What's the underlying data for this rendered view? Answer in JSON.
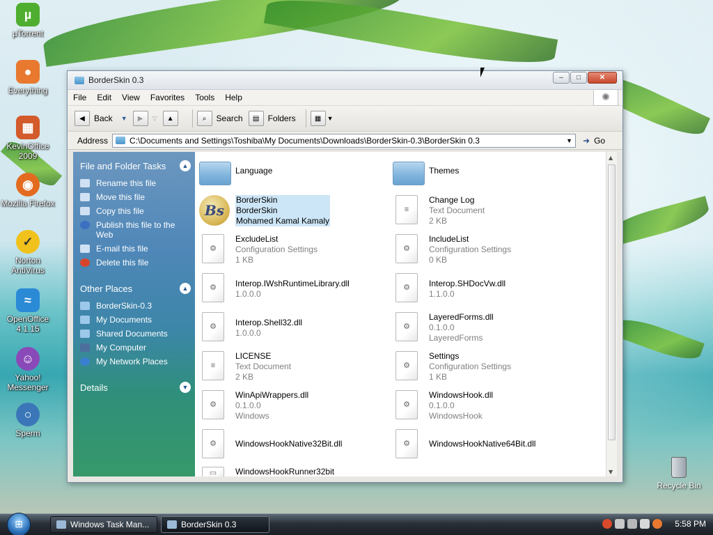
{
  "desktop": {
    "icons": [
      {
        "label": "µTorrent",
        "symbol": "µ",
        "color": "#4fae2f"
      },
      {
        "label": "Everything",
        "symbol": "●",
        "color": "#e8792f"
      },
      {
        "label": "KevinOffice 2009",
        "symbol": "▦",
        "color": "#d35a2b"
      },
      {
        "label": "Mozilla Firefox",
        "symbol": "◉",
        "color": "#e36b20"
      },
      {
        "label": "Norton AntiVirus",
        "symbol": "✓",
        "color": "#f0c21b"
      },
      {
        "label": "OpenOffice 4.1.15",
        "symbol": "≈",
        "color": "#2a8ad6"
      },
      {
        "label": "Yahoo! Messenger",
        "symbol": "☺",
        "color": "#8a49b8"
      },
      {
        "label": "Sperm",
        "symbol": "○",
        "color": "#3b77b8"
      }
    ],
    "recycle_bin_label": "Recycle Bin"
  },
  "window": {
    "title": "BorderSkin 0.3",
    "menu": [
      "File",
      "Edit",
      "View",
      "Favorites",
      "Tools",
      "Help"
    ],
    "toolbar": {
      "back_label": "Back",
      "search_label": "Search",
      "folders_label": "Folders"
    },
    "address": {
      "label": "Address",
      "value": "C:\\Documents and Settings\\Toshiba\\My Documents\\Downloads\\BorderSkin-0.3\\BorderSkin 0.3",
      "go_label": "Go"
    },
    "task_pane": {
      "file_tasks": {
        "title": "File and Folder Tasks",
        "items": [
          "Rename this file",
          "Move this file",
          "Copy this file",
          "Publish this file to the Web",
          "E-mail this file",
          "Delete this file"
        ]
      },
      "other_places": {
        "title": "Other Places",
        "items": [
          "BorderSkin-0.3",
          "My Documents",
          "Shared Documents",
          "My Computer",
          "My Network Places"
        ]
      },
      "details": {
        "title": "Details"
      }
    },
    "files": [
      {
        "name": "Language",
        "line2": "",
        "line3": "",
        "kind": "folder"
      },
      {
        "name": "Themes",
        "line2": "",
        "line3": "",
        "kind": "folder"
      },
      {
        "name": "BorderSkin",
        "line2": "BorderSkin",
        "line3": "Mohamed Kamal Kamaly",
        "kind": "app"
      },
      {
        "name": "Change Log",
        "line2": "Text Document",
        "line3": "2 KB",
        "kind": "text"
      },
      {
        "name": "ExcludeList",
        "line2": "Configuration Settings",
        "line3": "1 KB",
        "kind": "config"
      },
      {
        "name": "IncludeList",
        "line2": "Configuration Settings",
        "line3": "0 KB",
        "kind": "config"
      },
      {
        "name": "Interop.IWshRuntimeLibrary.dll",
        "line2": "1.0.0.0",
        "line3": "",
        "kind": "dll"
      },
      {
        "name": "Interop.SHDocVw.dll",
        "line2": "1.1.0.0",
        "line3": "",
        "kind": "dll"
      },
      {
        "name": "Interop.Shell32.dll",
        "line2": "1.0.0.0",
        "line3": "",
        "kind": "dll"
      },
      {
        "name": "LayeredForms.dll",
        "line2": "0.1.0.0",
        "line3": "LayeredForms",
        "kind": "dll"
      },
      {
        "name": "LICENSE",
        "line2": "Text Document",
        "line3": "2 KB",
        "kind": "text"
      },
      {
        "name": "Settings",
        "line2": "Configuration Settings",
        "line3": "1 KB",
        "kind": "config"
      },
      {
        "name": "WinApiWrappers.dll",
        "line2": "0.1.0.0",
        "line3": "Windows",
        "kind": "dll"
      },
      {
        "name": "WindowsHook.dll",
        "line2": "0.1.0.0",
        "line3": "WindowsHook",
        "kind": "dll"
      },
      {
        "name": "WindowsHookNative32Bit.dll",
        "line2": "",
        "line3": "",
        "kind": "dll"
      },
      {
        "name": "WindowsHookNative64Bit.dll",
        "line2": "",
        "line3": "",
        "kind": "dll"
      },
      {
        "name": "WindowsHookRunner32bit",
        "line2": "",
        "line3": "",
        "kind": "exe"
      }
    ]
  },
  "taskbar": {
    "buttons": [
      "Windows Task Man...",
      "BorderSkin 0.3"
    ],
    "clock": "5:58 PM"
  }
}
